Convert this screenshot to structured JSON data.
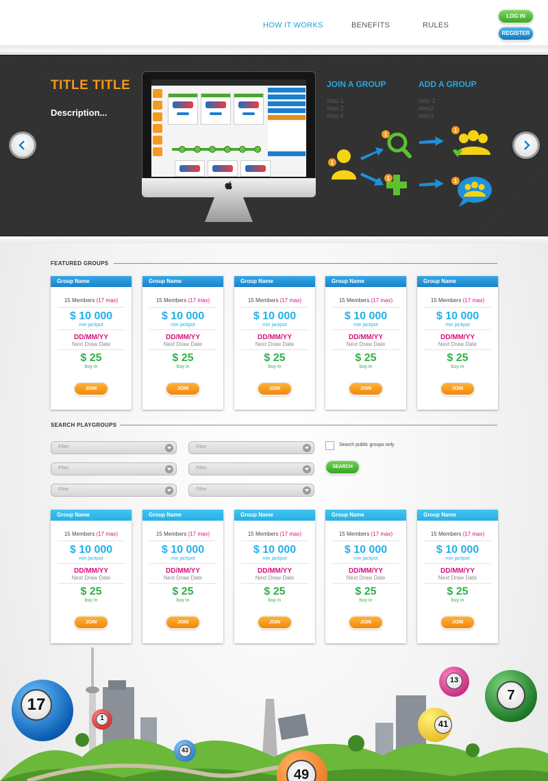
{
  "nav": {
    "items": [
      {
        "label": "HOW IT WORKS",
        "active": true
      },
      {
        "label": "BENEFITS",
        "active": false
      },
      {
        "label": "RULES",
        "active": false
      }
    ],
    "login_label": "LOG IN",
    "register_label": "REGISTER"
  },
  "hero": {
    "title": "TITLE TITLE",
    "description": "Description...",
    "join": {
      "title": "JOIN A GROUP",
      "steps": [
        "step 1",
        "step 2",
        "step 4"
      ]
    },
    "add": {
      "title": "ADD A GROUP",
      "steps": [
        "step 1",
        "step2",
        "step3"
      ]
    },
    "badge_number": "1"
  },
  "featured": {
    "heading": "FEATURED GROUPS",
    "cards": [
      {
        "name": "Group Name",
        "members": "15 Members",
        "max": "(17 max)",
        "jackpot": "$ 10 000",
        "jackpot_label": "min jackpot",
        "date": "DD/MM/YY",
        "date_label": "Next Draw Date",
        "buy": "$ 25",
        "buy_label": "buy in",
        "join": "JOIN"
      },
      {
        "name": "Group Name",
        "members": "15 Members",
        "max": "(17 max)",
        "jackpot": "$ 10 000",
        "jackpot_label": "min jackpot",
        "date": "DD/MM/YY",
        "date_label": "Next Draw Date",
        "buy": "$ 25",
        "buy_label": "buy in",
        "join": "JOIN"
      },
      {
        "name": "Group Name",
        "members": "15 Members",
        "max": "(17 max)",
        "jackpot": "$ 10 000",
        "jackpot_label": "min jackpot",
        "date": "DD/MM/YY",
        "date_label": "Next Draw Date",
        "buy": "$ 25",
        "buy_label": "buy in",
        "join": "JOIN"
      },
      {
        "name": "Group Name",
        "members": "15 Members",
        "max": "(17 max)",
        "jackpot": "$ 10 000",
        "jackpot_label": "min jackpot",
        "date": "DD/MM/YY",
        "date_label": "Next Draw Date",
        "buy": "$ 25",
        "buy_label": "buy in",
        "join": "JOIN"
      },
      {
        "name": "Group Name",
        "members": "15 Members",
        "max": "(17 max)",
        "jackpot": "$ 10 000",
        "jackpot_label": "min jackpot",
        "date": "DD/MM/YY",
        "date_label": "Next Draw Date",
        "buy": "$ 25",
        "buy_label": "buy in",
        "join": "JOIN"
      }
    ]
  },
  "search": {
    "heading": "SEARCH PLAYGROUPS",
    "filters": [
      "Filter",
      "Filter",
      "Filter",
      "Filter",
      "Filter",
      "Filter"
    ],
    "public_only_label": "Search public groups only",
    "search_label": "SEARCH",
    "cards": [
      {
        "name": "Group Name",
        "members": "15 Members",
        "max": "(17 max)",
        "jackpot": "$ 10 000",
        "jackpot_label": "min jackpot",
        "date": "DD/MM/YY",
        "date_label": "Next Draw Date",
        "buy": "$ 25",
        "buy_label": "buy in",
        "join": "JOIN"
      },
      {
        "name": "Group Name",
        "members": "15 Members",
        "max": "(17 max)",
        "jackpot": "$ 10 000",
        "jackpot_label": "min jackpot",
        "date": "DD/MM/YY",
        "date_label": "Next Draw Date",
        "buy": "$ 25",
        "buy_label": "buy in",
        "join": "JOIN"
      },
      {
        "name": "Group Name",
        "members": "15 Members",
        "max": "(17 max)",
        "jackpot": "$ 10 000",
        "jackpot_label": "min jackpot",
        "date": "DD/MM/YY",
        "date_label": "Next Draw Date",
        "buy": "$ 25",
        "buy_label": "buy in",
        "join": "JOIN"
      },
      {
        "name": "Group Name",
        "members": "15 Members",
        "max": "(17 max)",
        "jackpot": "$ 10 000",
        "jackpot_label": "min jackpot",
        "date": "DD/MM/YY",
        "date_label": "Next Draw Date",
        "buy": "$ 25",
        "buy_label": "buy in",
        "join": "JOIN"
      },
      {
        "name": "Group Name",
        "members": "15 Members",
        "max": "(17 max)",
        "jackpot": "$ 10 000",
        "jackpot_label": "min jackpot",
        "date": "DD/MM/YY",
        "date_label": "Next Draw Date",
        "buy": "$ 25",
        "buy_label": "buy in",
        "join": "JOIN"
      }
    ]
  },
  "balls": [
    "17",
    "1",
    "43",
    "49",
    "41",
    "13",
    "7"
  ],
  "icons": {
    "prev": "chevron-left-icon",
    "next": "chevron-right-icon",
    "dropdown": "chevron-down-icon",
    "person": "person-icon",
    "search": "magnifier-icon",
    "add": "plus-icon",
    "group": "group-icon",
    "chat": "chat-group-icon",
    "apple": "apple-logo-icon"
  },
  "colors": {
    "accent_blue": "#1ea0d8",
    "orange": "#f39a1e",
    "magenta": "#d5117a",
    "green": "#2fb04a"
  }
}
